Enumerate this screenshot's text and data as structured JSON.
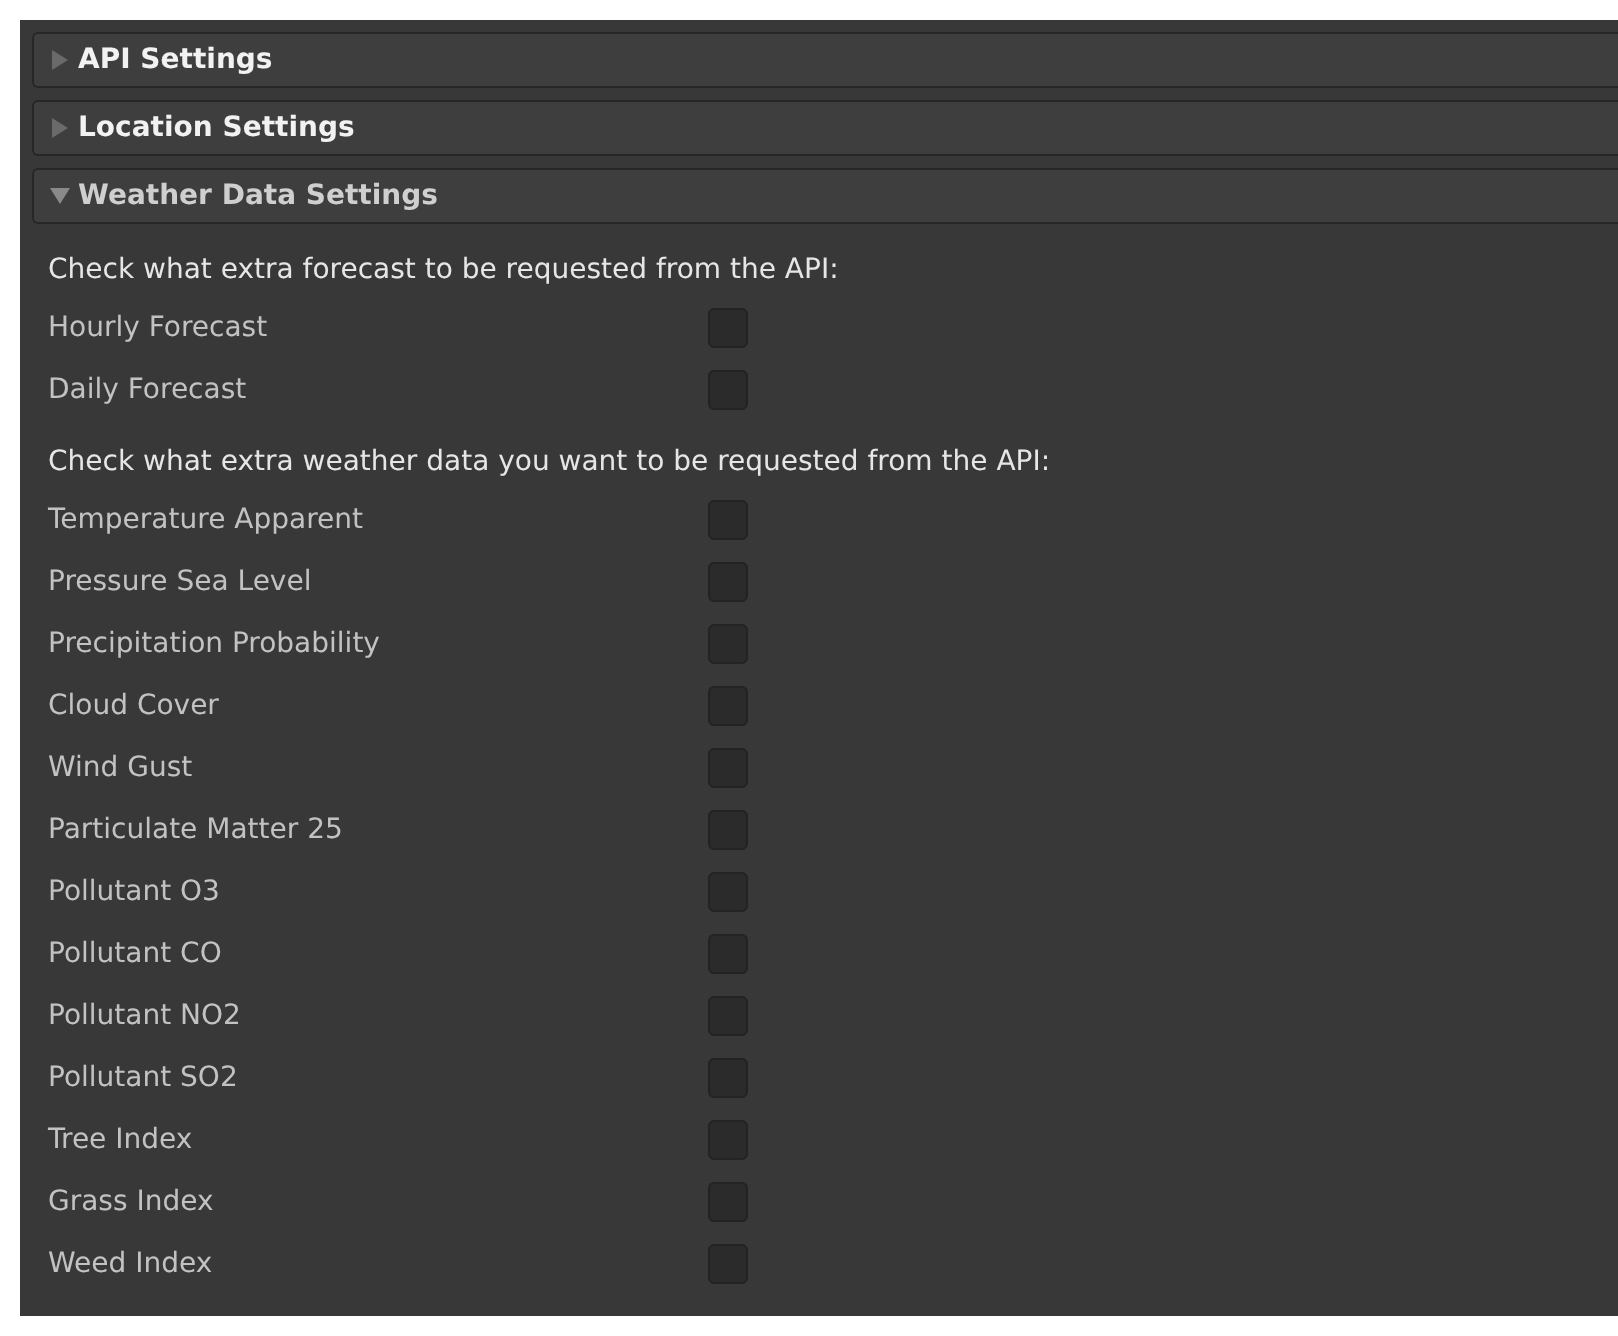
{
  "sections": [
    {
      "title": "API Settings",
      "expanded": false
    },
    {
      "title": "Location Settings",
      "expanded": false
    },
    {
      "title": "Weather Data Settings",
      "expanded": true,
      "groups": [
        {
          "note": "Check what extra forecast to be requested from the API:",
          "fields": [
            {
              "label": "Hourly Forecast",
              "checked": false
            },
            {
              "label": "Daily Forecast",
              "checked": false
            }
          ]
        },
        {
          "note": "Check what extra weather data you want to be requested from the API:",
          "fields": [
            {
              "label": "Temperature Apparent",
              "checked": false
            },
            {
              "label": "Pressure Sea Level",
              "checked": false
            },
            {
              "label": "Precipitation Probability",
              "checked": false
            },
            {
              "label": "Cloud Cover",
              "checked": false
            },
            {
              "label": "Wind Gust",
              "checked": false
            },
            {
              "label": "Particulate Matter 25",
              "checked": false
            },
            {
              "label": "Pollutant O3",
              "checked": false
            },
            {
              "label": "Pollutant CO",
              "checked": false
            },
            {
              "label": "Pollutant NO2",
              "checked": false
            },
            {
              "label": "Pollutant SO2",
              "checked": false
            },
            {
              "label": "Tree Index",
              "checked": false
            },
            {
              "label": "Grass Index",
              "checked": false
            },
            {
              "label": "Weed Index",
              "checked": false
            }
          ]
        }
      ]
    }
  ]
}
